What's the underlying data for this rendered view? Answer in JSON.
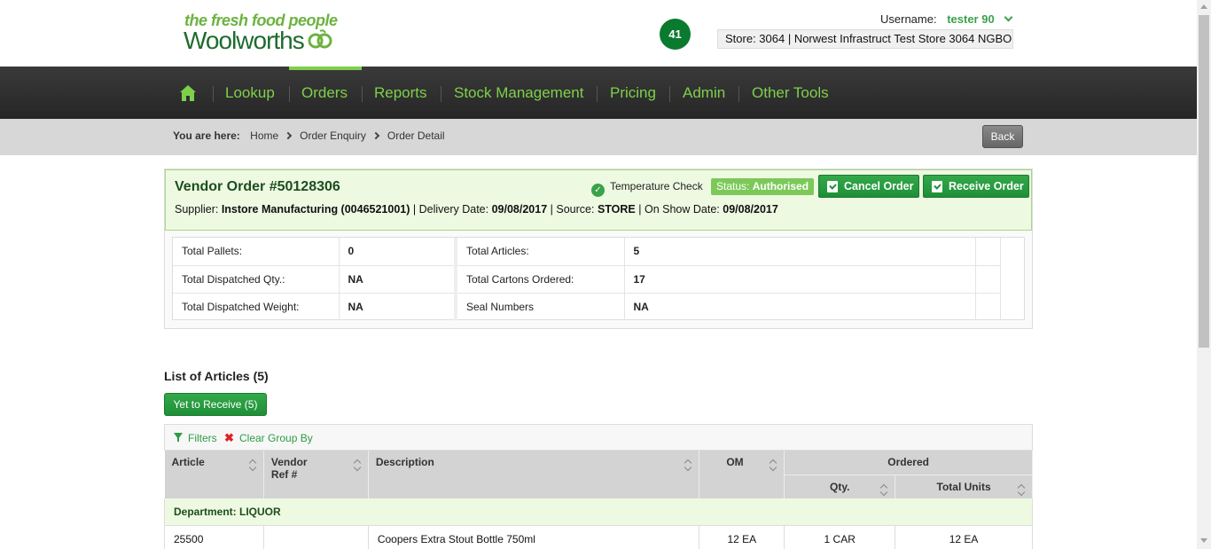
{
  "brand": {
    "tagline": "the fresh food people",
    "name": "Woolworths"
  },
  "header": {
    "notification_count": "41",
    "username_label": "Username:",
    "username": "tester 90",
    "store": "Store: 3064 | Norwest Infrastruct Test Store 3064 NGBO"
  },
  "nav": {
    "items": [
      "Lookup",
      "Orders",
      "Reports",
      "Stock Management",
      "Pricing",
      "Admin",
      "Other Tools"
    ],
    "active": "Orders"
  },
  "breadcrumb": {
    "label": "You are here:",
    "items": [
      "Home",
      "Order Enquiry",
      "Order Detail"
    ],
    "back": "Back"
  },
  "order": {
    "title": "Vendor Order #50128306",
    "supplier_label": "Supplier:",
    "supplier": "Instore Manufacturing (0046521001)",
    "delivery_label": "| Delivery Date:",
    "delivery": "09/08/2017",
    "source_label": "| Source:",
    "source": "STORE",
    "onshow_label": "| On Show Date:",
    "onshow": "09/08/2017",
    "temp_check": "Temperature Check",
    "status_label": "Status:",
    "status": "Authorised",
    "cancel": "Cancel Order",
    "receive": "Receive Order",
    "stats": [
      {
        "l1": "Total Pallets:",
        "v1": "0",
        "l2": "Total Articles:",
        "v2": "5"
      },
      {
        "l1": "Total Dispatched Qty.:",
        "v1": "NA",
        "l2": "Total Cartons Ordered:",
        "v2": "17"
      },
      {
        "l1": "Total Dispatched Weight:",
        "v1": "NA",
        "l2": "Seal Numbers",
        "v2": "NA"
      }
    ]
  },
  "articles": {
    "title": "List of Articles (5)",
    "yet_to_receive": "Yet to Receive (5)",
    "filters": "Filters",
    "clear_group": "Clear Group By",
    "headers": {
      "article": "Article",
      "vendor_ref": "Vendor Ref #",
      "description": "Description",
      "om": "OM",
      "ordered": "Ordered",
      "qty": "Qty.",
      "total_units": "Total Units"
    },
    "department": "Department: LIQUOR",
    "rows": [
      {
        "article": "25500",
        "vendor_ref": "",
        "description": "Coopers Extra Stout Bottle 750ml",
        "om": "12 EA",
        "qty": "1 CAR",
        "total_units": "12 EA"
      }
    ]
  }
}
